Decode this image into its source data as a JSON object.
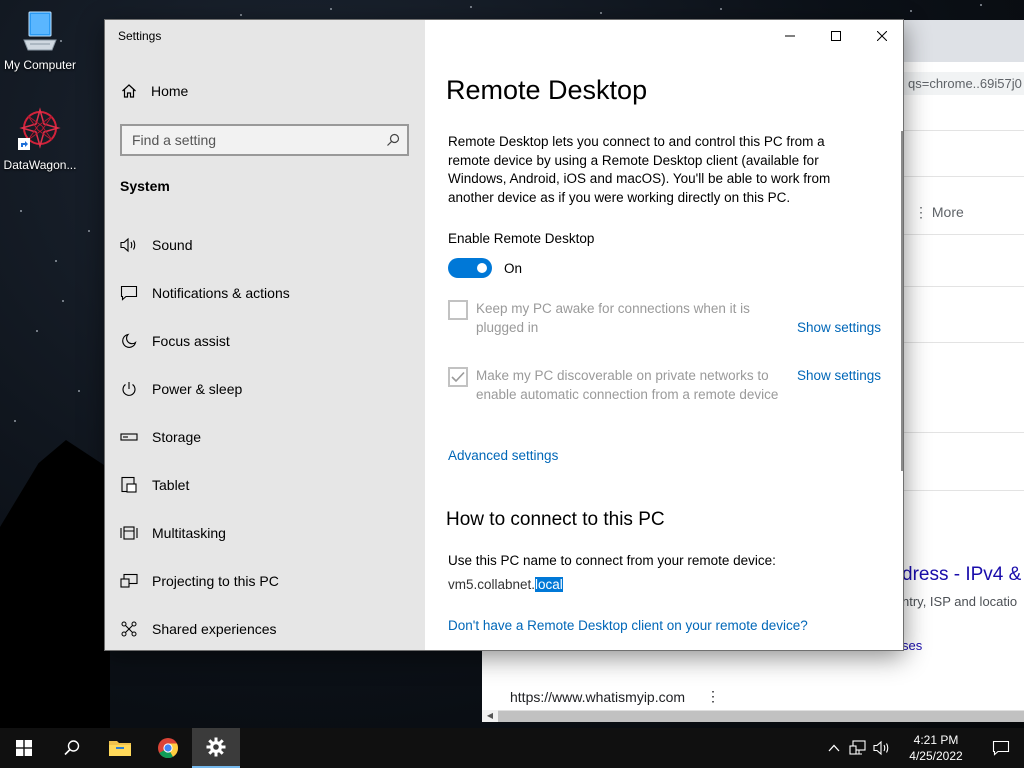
{
  "desktop": {
    "icons": [
      {
        "label": "My Computer",
        "icon": "computer-icon"
      },
      {
        "label": "DataWagon...",
        "icon": "datawagon-shortcut-icon"
      }
    ]
  },
  "browser": {
    "url_fragment": "qs=chrome..69i57j0",
    "more_label": "More",
    "result_title": "dress - IPv4 &",
    "result_snippet": "ntry, ISP and locatio",
    "result_snippet2": "ses",
    "result_url": "https://www.whatismyip.com",
    "result_url_menu": "⋮"
  },
  "settings": {
    "window_title": "Settings",
    "home_label": "Home",
    "search_placeholder": "Find a setting",
    "section_label": "System",
    "nav_items": [
      {
        "label": "Sound",
        "icon": "speaker-icon"
      },
      {
        "label": "Notifications & actions",
        "icon": "notification-icon"
      },
      {
        "label": "Focus assist",
        "icon": "moon-icon"
      },
      {
        "label": "Power & sleep",
        "icon": "power-icon"
      },
      {
        "label": "Storage",
        "icon": "storage-icon"
      },
      {
        "label": "Tablet",
        "icon": "tablet-icon"
      },
      {
        "label": "Multitasking",
        "icon": "multitasking-icon"
      },
      {
        "label": "Projecting to this PC",
        "icon": "projecting-icon"
      },
      {
        "label": "Shared experiences",
        "icon": "shared-experiences-icon"
      }
    ],
    "page_title": "Remote Desktop",
    "description": "Remote Desktop lets you connect to and control this PC from a remote device by using a Remote Desktop client (available for Windows, Android, iOS and macOS). You'll be able to work from another device as if you were working directly on this PC.",
    "enable_label": "Enable Remote Desktop",
    "enable_state": "On",
    "enabled": true,
    "option_awake": {
      "text": "Keep my PC awake for connections when it is plugged in",
      "checked": false,
      "link": "Show settings"
    },
    "option_discoverable": {
      "text": "Make my PC discoverable on private networks to enable automatic connection from a remote device",
      "checked": true,
      "link": "Show settings"
    },
    "advanced_link": "Advanced settings",
    "how_title": "How to connect to this PC",
    "use_name_text": "Use this PC name to connect from your remote device:",
    "pc_name_prefix": "vm5.collabnet.",
    "pc_name_selected": "local",
    "client_link": "Don't have a Remote Desktop client on your remote device?"
  },
  "taskbar": {
    "apps": [
      {
        "name": "start-button",
        "icon": "windows-logo-icon"
      },
      {
        "name": "search-button",
        "icon": "search-icon"
      },
      {
        "name": "file-explorer-button",
        "icon": "folder-icon"
      },
      {
        "name": "chrome-button",
        "icon": "chrome-icon"
      },
      {
        "name": "settings-button",
        "icon": "gear-icon"
      }
    ],
    "time": "4:21 PM",
    "date": "4/25/2022"
  },
  "colors": {
    "accent": "#0078d7",
    "link": "#0067b8",
    "nav_bg": "#e6e6e6",
    "taskbar_bg": "#101010"
  }
}
